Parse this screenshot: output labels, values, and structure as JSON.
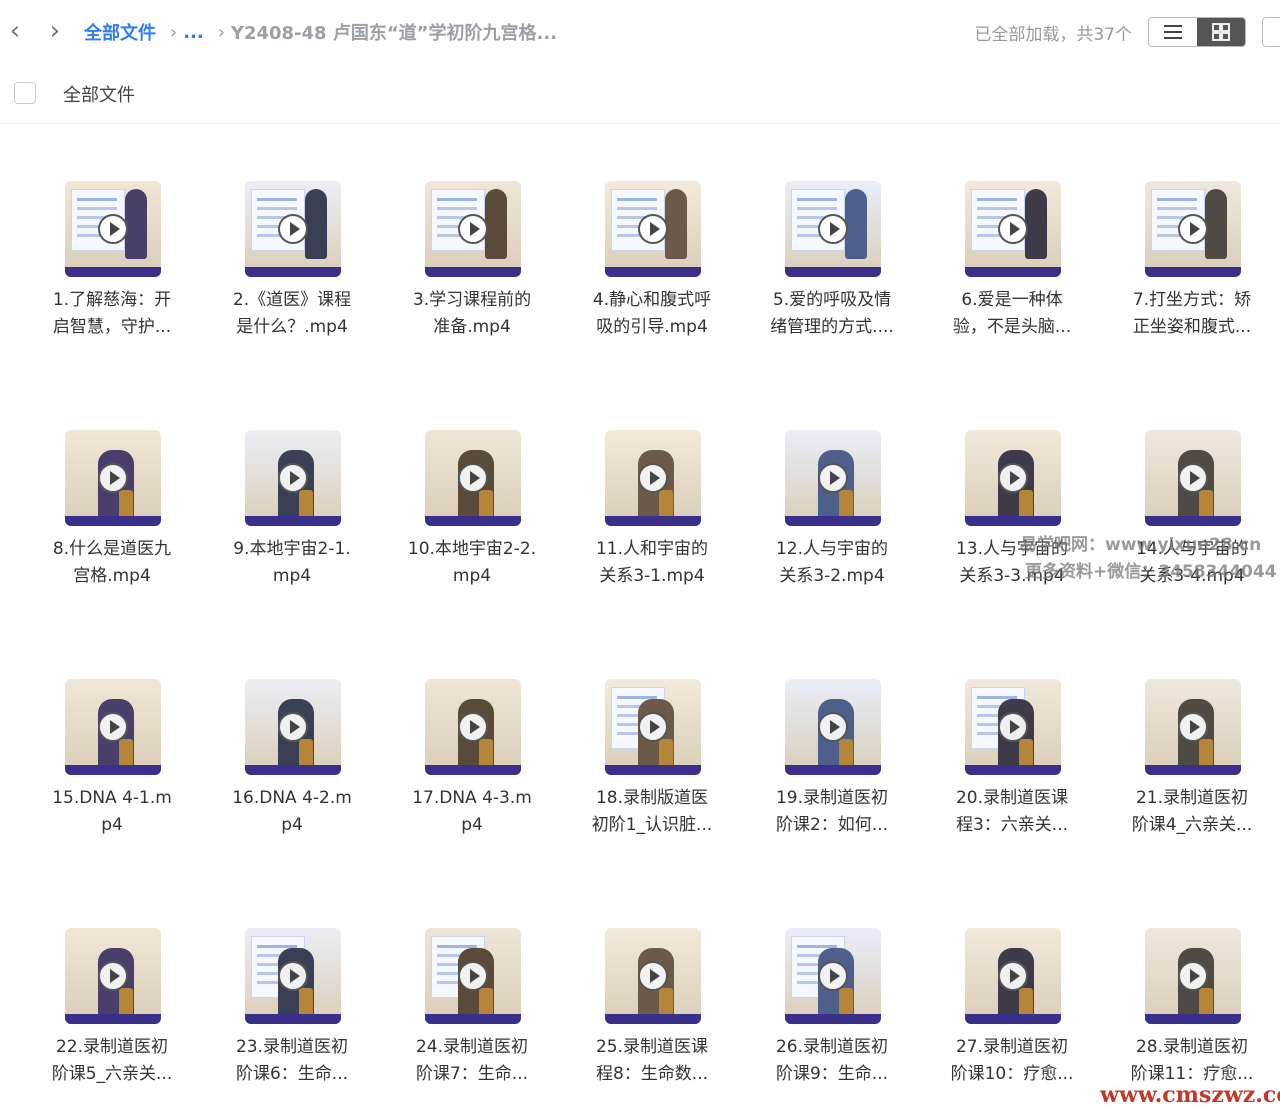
{
  "breadcrumb": {
    "root": "全部文件",
    "ellipsis": "...",
    "current": "Y2408-48 卢国东“道”学初阶九宫格..."
  },
  "status": "已全部加载，共37个",
  "header": {
    "title": "全部文件"
  },
  "files": [
    {
      "line1": "1.了解慈海：开",
      "line2": "启智慧，守护..."
    },
    {
      "line1": "2.《道医》课程",
      "line2": "是什么？.mp4"
    },
    {
      "line1": "3.学习课程前的",
      "line2": "准备.mp4"
    },
    {
      "line1": "4.静心和腹式呼",
      "line2": "吸的引导.mp4"
    },
    {
      "line1": "5.爱的呼吸及情",
      "line2": "绪管理的方式...."
    },
    {
      "line1": "6.爱是一种体",
      "line2": "验，不是头脑..."
    },
    {
      "line1": "7.打坐方式：矫",
      "line2": "正坐姿和腹式..."
    },
    {
      "line1": "8.什么是道医九",
      "line2": "宫格.mp4"
    },
    {
      "line1": "9.本地宇宙2-1.",
      "line2": "mp4"
    },
    {
      "line1": "10.本地宇宙2-2.",
      "line2": "mp4"
    },
    {
      "line1": "11.人和宇宙的",
      "line2": "关系3-1.mp4"
    },
    {
      "line1": "12.人与宇宙的",
      "line2": "关系3-2.mp4"
    },
    {
      "line1": "13.人与宇宙的",
      "line2": "关系3-3.mp4"
    },
    {
      "line1": "14.人与宇宙的",
      "line2": "关系3-4.mp4"
    },
    {
      "line1": "15.DNA 4-1.m",
      "line2": "p4"
    },
    {
      "line1": "16.DNA 4-2.m",
      "line2": "p4"
    },
    {
      "line1": "17.DNA 4-3.m",
      "line2": "p4"
    },
    {
      "line1": "18.录制版道医",
      "line2": "初阶1_认识脏..."
    },
    {
      "line1": "19.录制道医初",
      "line2": "阶课2：如何..."
    },
    {
      "line1": "20.录制道医课",
      "line2": "程3：六亲关..."
    },
    {
      "line1": "21.录制道医初",
      "line2": "阶课4_六亲关..."
    },
    {
      "line1": "22.录制道医初",
      "line2": "阶课5_六亲关..."
    },
    {
      "line1": "23.录制道医初",
      "line2": "阶课6：生命..."
    },
    {
      "line1": "24.录制道医初",
      "line2": "阶课7：生命..."
    },
    {
      "line1": "25.录制道医课",
      "line2": "程8：生命数..."
    },
    {
      "line1": "26.录制道医初",
      "line2": "阶课9：生命..."
    },
    {
      "line1": "27.录制道医初",
      "line2": "阶课10：疗愈..."
    },
    {
      "line1": "28.录制道医初",
      "line2": "阶课11：疗愈..."
    }
  ],
  "watermarks": {
    "line1": "易学吧网：www.yixue28.cn",
    "line2": "更多资料+微信：3458344044",
    "line3": "www.cmszwz.com"
  },
  "colors": {
    "accent": "#2f7bf5",
    "muted": "#9aa0a6",
    "watermark_red": "#c0392b"
  },
  "icons": {
    "back": "chevron-left-icon",
    "forward": "chevron-right-icon",
    "list_view": "list-view-icon",
    "grid_view": "grid-view-icon",
    "play": "play-icon"
  }
}
